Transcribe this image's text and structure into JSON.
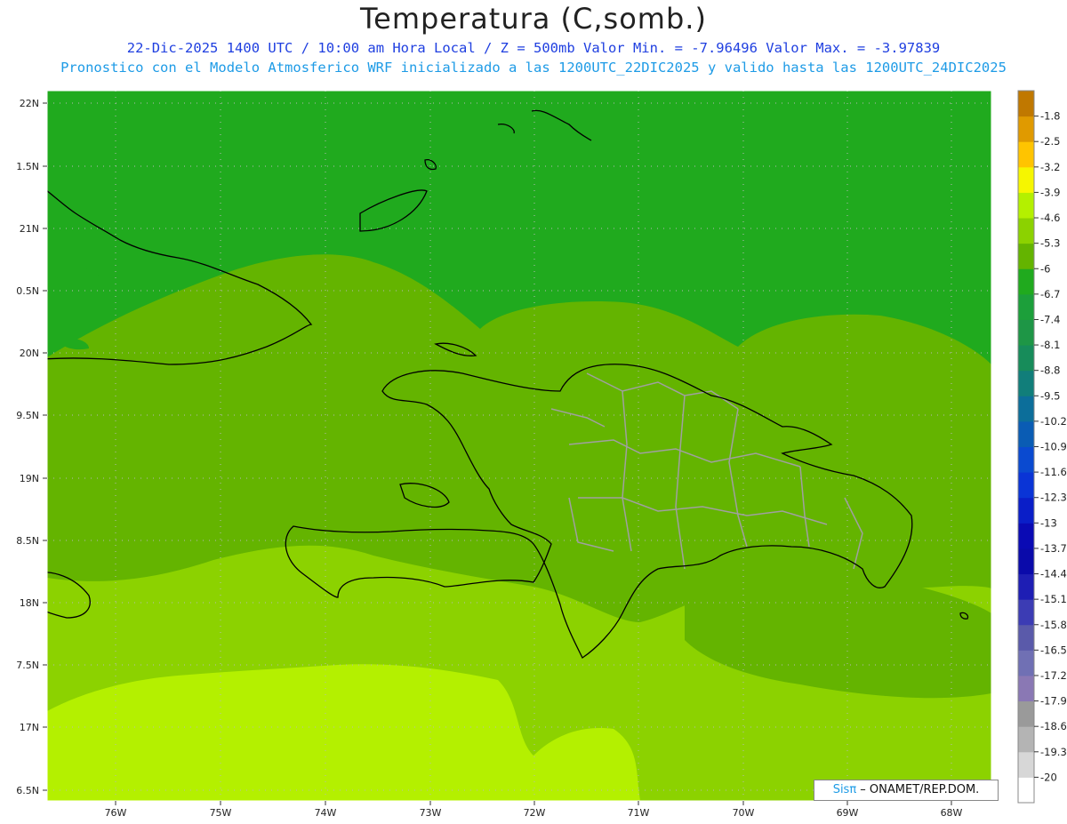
{
  "title": "Temperatura (C,somb.)",
  "subtitle_line1": "22-Dic-2025  1400 UTC / 10:00 am Hora Local / Z = 500mb  Valor Min. = -7.96496  Valor Max. = -3.97839",
  "subtitle_line2": "Pronostico con el Modelo Atmosferico WRF inicializado a las 1200UTC_22DIC2025 y valido hasta las  1200UTC_24DIC2025",
  "y_axis_labels": [
    "22N",
    "1.5N",
    "21N",
    "0.5N",
    "20N",
    "9.5N",
    "19N",
    "8.5N",
    "18N",
    "7.5N",
    "17N",
    "6.5N"
  ],
  "x_axis_labels": [
    "76W",
    "75W",
    "74W",
    "73W",
    "72W",
    "71W",
    "70W",
    "69W",
    "68W"
  ],
  "colorbar": {
    "labels": [
      "-1.8",
      "-2.5",
      "-3.2",
      "-3.9",
      "-4.6",
      "-5.3",
      "-6",
      "-6.7",
      "-7.4",
      "-8.1",
      "-8.8",
      "-9.5",
      "-10.2",
      "-10.9",
      "-11.6",
      "-12.3",
      "-13",
      "-13.7",
      "-14.4",
      "-15.1",
      "-15.8",
      "-16.5",
      "-17.2",
      "-17.9",
      "-18.6",
      "-19.3",
      "-20"
    ],
    "colors": [
      "#c07800",
      "#e09a00",
      "#ffc400",
      "#f6f600",
      "#b4f000",
      "#8cd200",
      "#64b400",
      "#20aa1e",
      "#1c9f3a",
      "#1e9646",
      "#178c5a",
      "#117e7a",
      "#0c6e9a",
      "#0a5cb4",
      "#0a4ad0",
      "#0a34d6",
      "#0a1ec8",
      "#0a0ab4",
      "#0a0aaa",
      "#1e1eb4",
      "#3c3cb4",
      "#5a5aaa",
      "#7070b4",
      "#8a78b4",
      "#9a9a9a",
      "#b4b4b4",
      "#d7d7d7",
      "#ffffff"
    ]
  },
  "field_colors": {
    "c_minus_6_7": "#20aa1e",
    "c_minus_6": "#64b400",
    "c_minus_5_3": "#8cd200",
    "c_minus_4_6": "#b4f000",
    "coast": "#000000",
    "provinces": "#a0a0a0"
  },
  "credit": {
    "sis": "Sis",
    "pi": "π",
    "rest": " – ONAMET/REP.DOM."
  }
}
